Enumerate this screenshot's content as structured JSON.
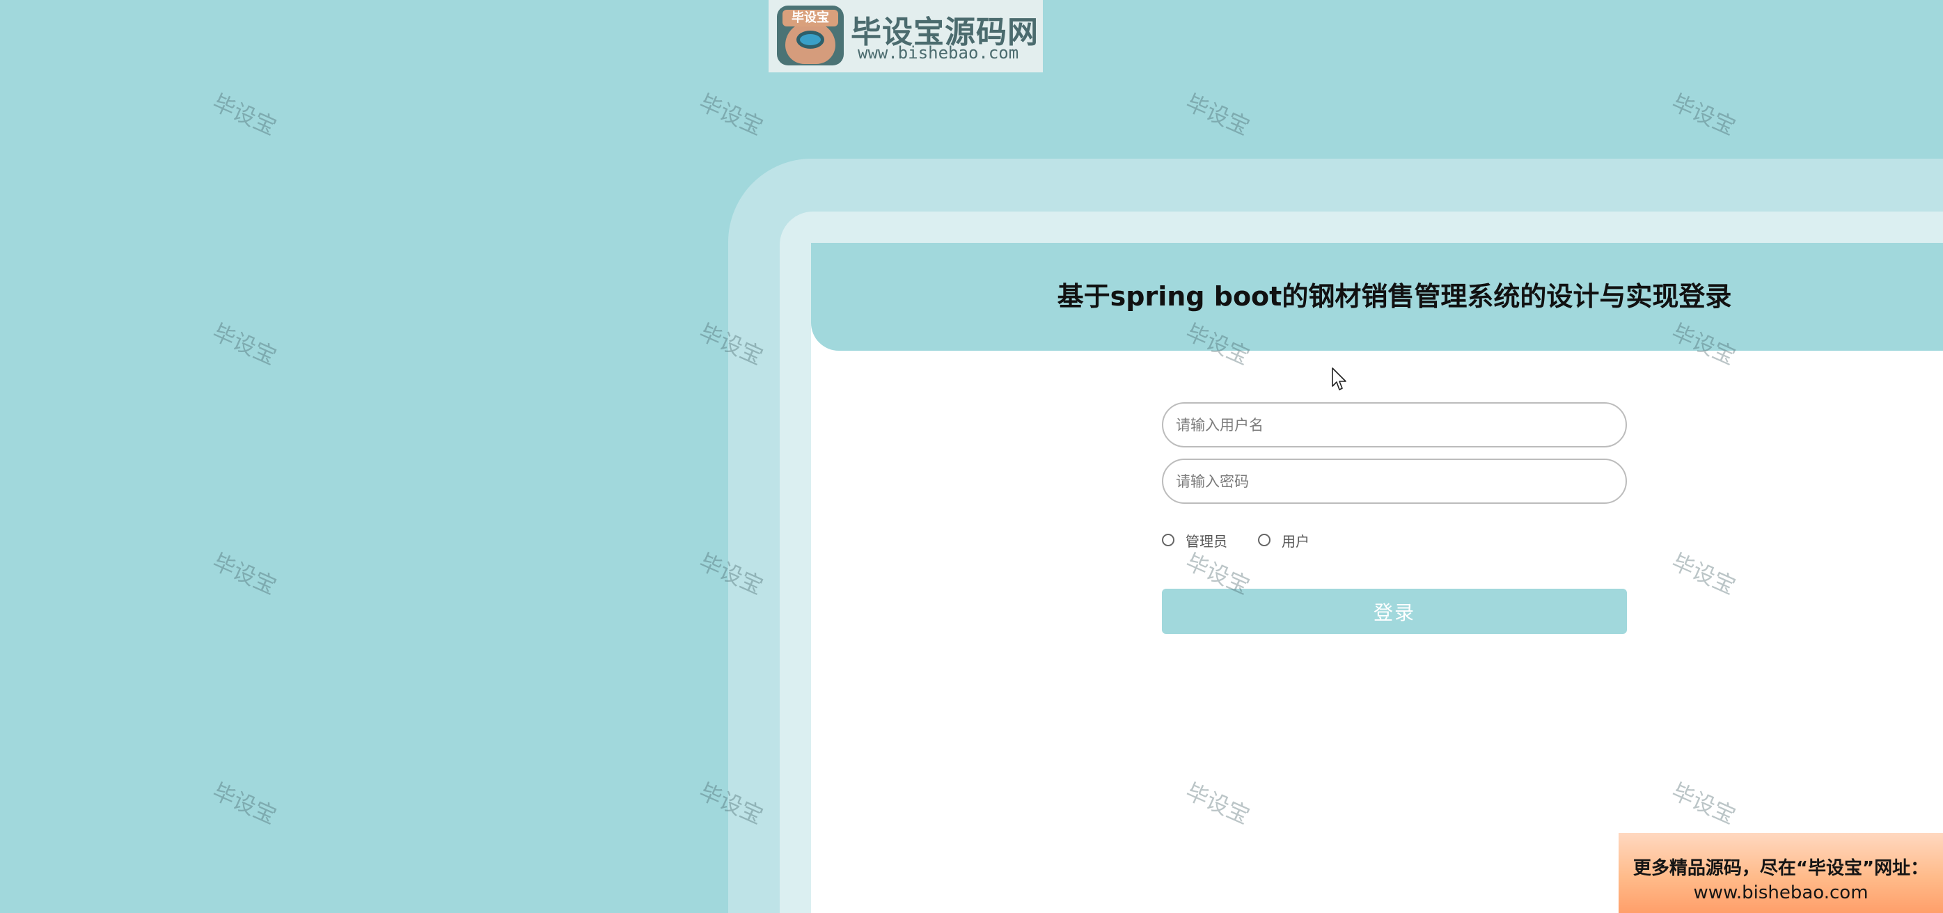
{
  "logo": {
    "badge_text": "毕设宝",
    "title": "毕设宝源码网",
    "url": "www.bishebao.com"
  },
  "watermark": {
    "text": "毕设宝",
    "color": "#3c5a5f"
  },
  "login": {
    "title": "基于spring boot的钢材销售管理系统的设计与实现登录",
    "username_placeholder": "请输入用户名",
    "password_placeholder": "请输入密码",
    "roles": [
      "管理员",
      "用户"
    ],
    "submit_label": "登录"
  },
  "promo": {
    "line1": "更多精品源码，尽在“毕设宝”网址：",
    "line2": "www.bishebao.com"
  },
  "colors": {
    "background": "#a1d8dc",
    "header": "#a1d8dc",
    "button": "#a1d8dc",
    "frame_outer": "#bee3e7",
    "frame_inner": "#dbeff1"
  }
}
